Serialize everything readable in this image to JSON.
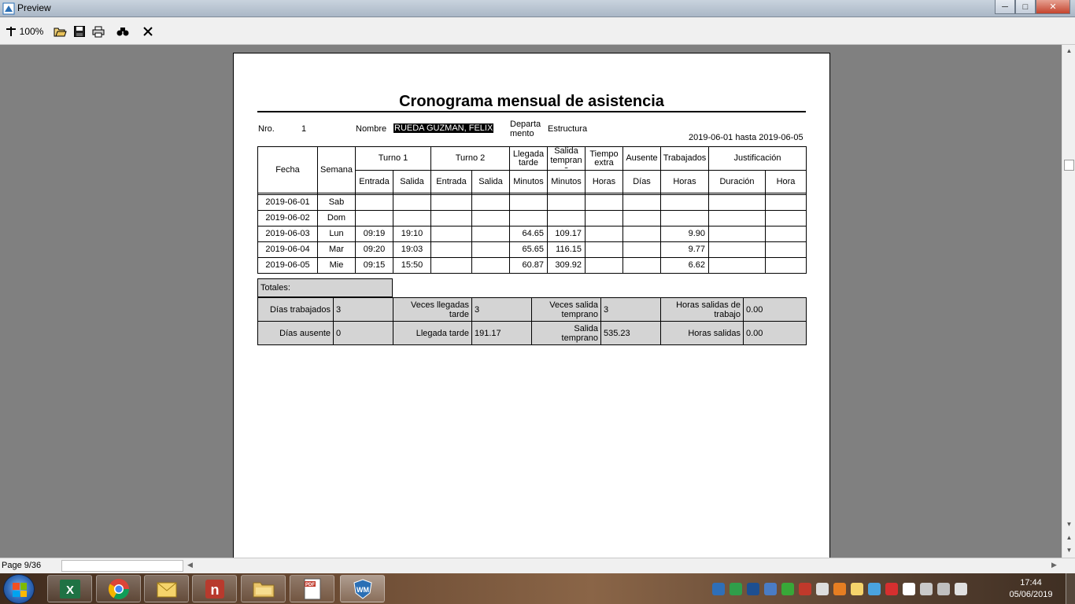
{
  "window": {
    "title": "Preview",
    "buttons": [
      "minimize",
      "maximize",
      "close"
    ]
  },
  "toolbar": {
    "zoom_label": "100%",
    "icons": [
      "zoom-icon",
      "open-folder-icon",
      "save-icon",
      "print-icon",
      "find-icon",
      "close-icon"
    ]
  },
  "report": {
    "title": "Cronograma mensual de asistencia",
    "nro_label": "Nro.",
    "nro_value": "1",
    "nombre_label": "Nombre",
    "nombre_value": "RUEDA GUZMAN, FELIX",
    "departamento_label_1": "Departa",
    "departamento_label_2": "mento",
    "departamento_value": "Estructura",
    "date_range": "2019-06-01 hasta 2019-06-05",
    "headers": {
      "fecha": "Fecha",
      "semana": "Semana",
      "turno1": "Turno 1",
      "turno2": "Turno 2",
      "llegada_1": "Llegada",
      "llegada_2": "tarde",
      "salida_1": "Salida",
      "salida_2": "tempran",
      "salida_3": "o",
      "tiempo_1": "Tiempo",
      "tiempo_2": "extra",
      "ausente": "Ausente",
      "trabajados": "Trabajados",
      "justificacion": "Justificación",
      "entrada": "Entrada",
      "salida": "Salida",
      "minutos": "Minutos",
      "horas": "Horas",
      "dias": "Días",
      "duracion": "Duración",
      "hora": "Hora"
    },
    "rows": [
      {
        "fecha": "2019-06-01",
        "semana": "Sab",
        "t1_entrada": "",
        "t1_salida": "",
        "t2_entrada": "",
        "t2_salida": "",
        "llegada": "",
        "salida_temprano": "",
        "tiempo_extra": "",
        "ausente": "",
        "trabajados": "",
        "duracion": "",
        "hora": ""
      },
      {
        "fecha": "2019-06-02",
        "semana": "Dom",
        "t1_entrada": "",
        "t1_salida": "",
        "t2_entrada": "",
        "t2_salida": "",
        "llegada": "",
        "salida_temprano": "",
        "tiempo_extra": "",
        "ausente": "",
        "trabajados": "",
        "duracion": "",
        "hora": ""
      },
      {
        "fecha": "2019-06-03",
        "semana": "Lun",
        "t1_entrada": "09:19",
        "t1_salida": "19:10",
        "t2_entrada": "",
        "t2_salida": "",
        "llegada": "64.65",
        "salida_temprano": "109.17",
        "tiempo_extra": "",
        "ausente": "",
        "trabajados": "9.90",
        "duracion": "",
        "hora": ""
      },
      {
        "fecha": "2019-06-04",
        "semana": "Mar",
        "t1_entrada": "09:20",
        "t1_salida": "19:03",
        "t2_entrada": "",
        "t2_salida": "",
        "llegada": "65.65",
        "salida_temprano": "116.15",
        "tiempo_extra": "",
        "ausente": "",
        "trabajados": "9.77",
        "duracion": "",
        "hora": ""
      },
      {
        "fecha": "2019-06-05",
        "semana": "Mie",
        "t1_entrada": "09:15",
        "t1_salida": "15:50",
        "t2_entrada": "",
        "t2_salida": "",
        "llegada": "60.87",
        "salida_temprano": "309.92",
        "tiempo_extra": "",
        "ausente": "",
        "trabajados": "6.62",
        "duracion": "",
        "hora": ""
      }
    ],
    "totales": {
      "label": "Totales:",
      "dias_trabajados_label": "Días trabajados",
      "dias_trabajados": "3",
      "veces_llegadas_label_1": "Veces llegadas",
      "veces_llegadas_label_2": "tarde",
      "veces_llegadas": "3",
      "veces_salida_label_1": "Veces salida",
      "veces_salida_label_2": "temprano",
      "veces_salida": "3",
      "horas_salidas_trabajo_label_1": "Horas salidas de",
      "horas_salidas_trabajo_label_2": "trabajo",
      "horas_salidas_trabajo": "0.00",
      "dias_ausente_label": "Días ausente",
      "dias_ausente": "0",
      "llegada_tarde_label": "Llegada tarde",
      "llegada_tarde": "191.17",
      "salida_temprano_label_1": "Salida",
      "salida_temprano_label_2": "temprano",
      "salida_temprano": "535.23",
      "horas_salidas_label": "Horas salidas",
      "horas_salidas": "0.00"
    }
  },
  "statusbar": {
    "page": "Page 9/36"
  },
  "taskbar": {
    "apps": [
      "excel-icon",
      "chrome-icon",
      "outlook-icon",
      "n-app-icon",
      "file-explorer-icon",
      "pdf-icon",
      "shield-app-icon"
    ],
    "time": "17:44",
    "date": "05/06/2019"
  },
  "colors": {
    "page_bg": "#808080",
    "totals_bg": "#d4d4d4",
    "highlight_bg": "#000000"
  }
}
